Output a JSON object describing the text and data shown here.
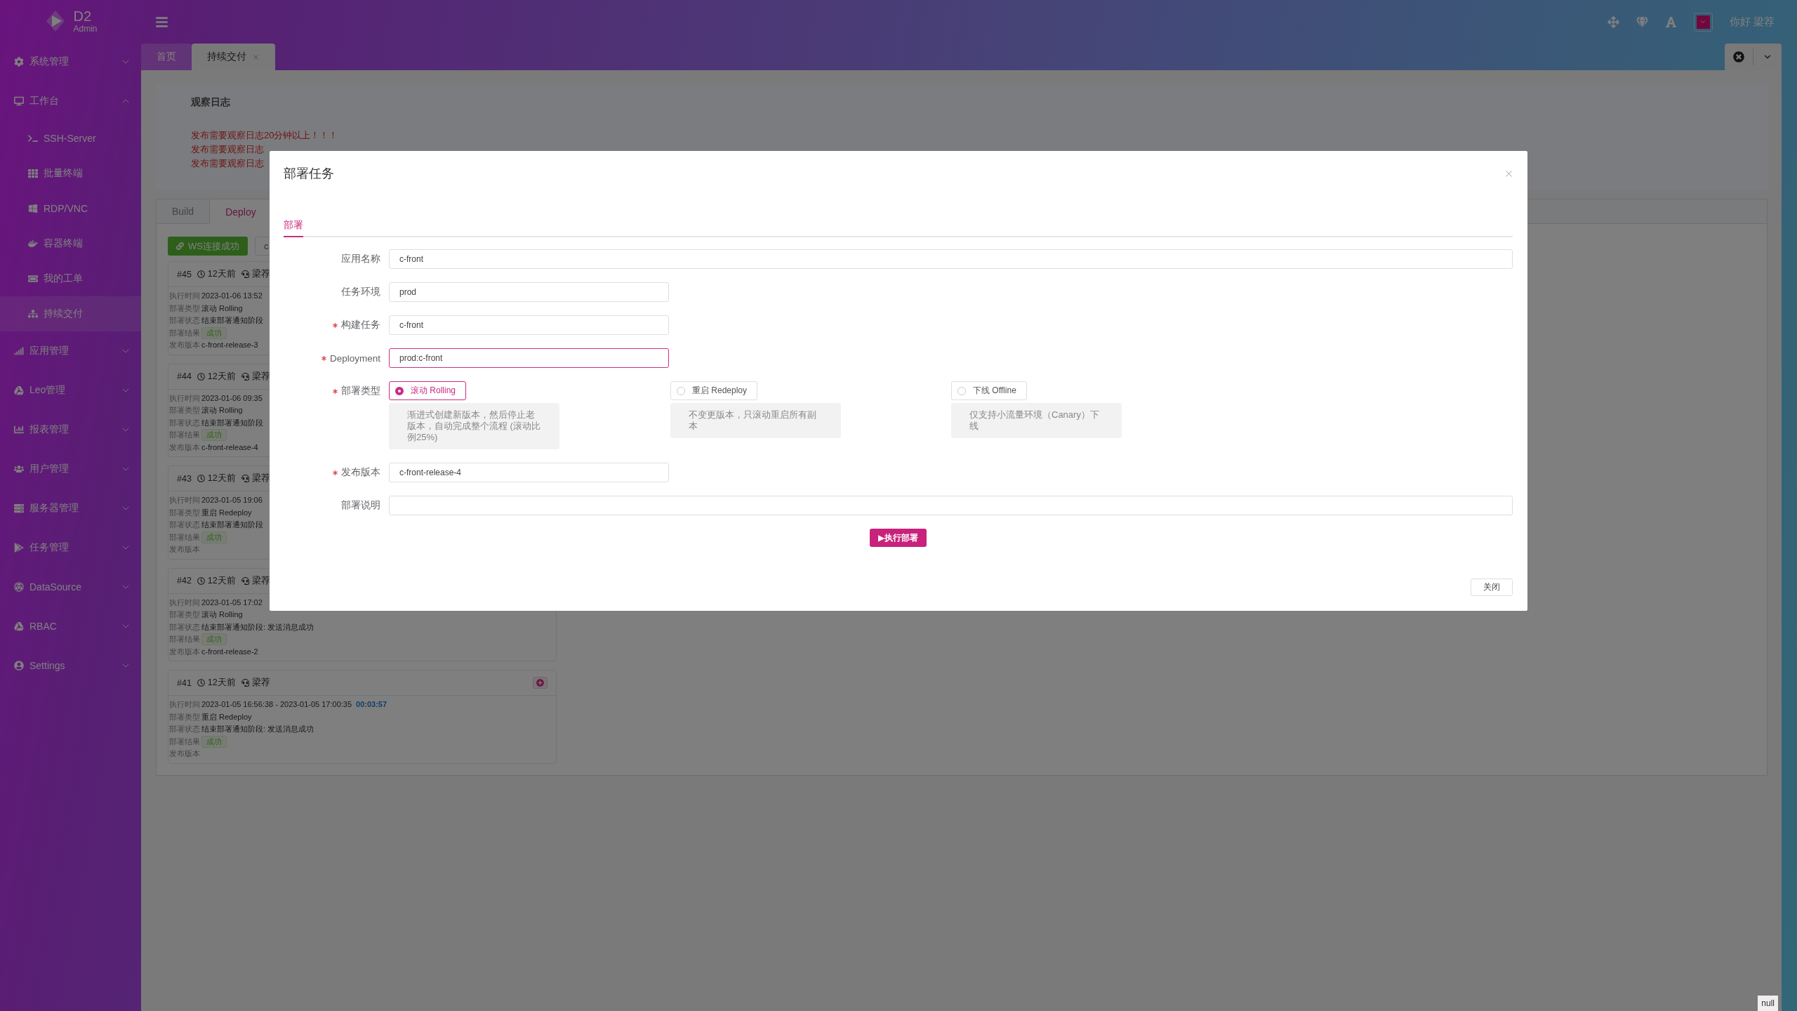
{
  "brand": {
    "name": "D2",
    "sub": "Admin"
  },
  "sidebar": {
    "items": [
      {
        "label": "系统管理",
        "expanded": false,
        "selected": false
      },
      {
        "label": "工作台",
        "expanded": true,
        "selected": false,
        "children": [
          {
            "label": "SSH-Server",
            "selected": false
          },
          {
            "label": "批量终端",
            "selected": false
          },
          {
            "label": "RDP/VNC",
            "selected": false
          },
          {
            "label": "容器终端",
            "selected": false
          },
          {
            "label": "我的工单",
            "selected": false
          },
          {
            "label": "持续交付",
            "selected": true
          }
        ]
      },
      {
        "label": "应用管理",
        "expanded": false,
        "selected": false
      },
      {
        "label": "Leo管理",
        "expanded": false,
        "selected": false
      },
      {
        "label": "报表管理",
        "expanded": false,
        "selected": false
      },
      {
        "label": "用户管理",
        "expanded": false,
        "selected": false
      },
      {
        "label": "服务器管理",
        "expanded": false,
        "selected": false
      },
      {
        "label": "任务管理",
        "expanded": false,
        "selected": false
      },
      {
        "label": "DataSource",
        "expanded": false,
        "selected": false
      },
      {
        "label": "RBAC",
        "expanded": false,
        "selected": false
      },
      {
        "label": "Settings",
        "expanded": false,
        "selected": false
      }
    ]
  },
  "header": {
    "greeting": "你好 梁荐"
  },
  "page_tabs": [
    {
      "label": "首页",
      "selected": false,
      "closable": false
    },
    {
      "label": "持续交付",
      "selected": true,
      "closable": true
    }
  ],
  "log": {
    "title": "观察日志",
    "lines": [
      "发布需要观察日志20分钟以上！！！",
      "发布需要观察日志",
      "发布需要观察日志"
    ]
  },
  "work_tabs": [
    {
      "label": "Build",
      "selected": false
    },
    {
      "label": "Deploy",
      "selected": true
    }
  ],
  "toolbar": {
    "ws_button": "WS连接成功",
    "second_button": "c"
  },
  "records": [
    {
      "id": "#45",
      "age": "12天前",
      "user": "梁荐",
      "fields": [
        {
          "label": "执行时间",
          "value": "2023-01-06 13:52"
        },
        {
          "label": "部署类型",
          "value": "滚动 Rolling"
        },
        {
          "label": "部署状态",
          "value": "结束部署通知阶段"
        },
        {
          "label": "部署结果",
          "value": "成功",
          "kind": "tag"
        },
        {
          "label": "发布版本",
          "value": "c-front-release-3"
        }
      ]
    },
    {
      "id": "#44",
      "age": "12天前",
      "user": "梁荐",
      "fields": [
        {
          "label": "执行时间",
          "value": "2023-01-06 09:35"
        },
        {
          "label": "部署类型",
          "value": "滚动 Rolling"
        },
        {
          "label": "部署状态",
          "value": "结束部署通知阶段"
        },
        {
          "label": "部署结果",
          "value": "成功",
          "kind": "tag"
        },
        {
          "label": "发布版本",
          "value": "c-front-release-4"
        }
      ]
    },
    {
      "id": "#43",
      "age": "12天前",
      "user": "梁荐",
      "fields": [
        {
          "label": "执行时间",
          "value": "2023-01-05 19:06"
        },
        {
          "label": "部署类型",
          "value": "重启 Redeploy"
        },
        {
          "label": "部署状态",
          "value": "结束部署通知阶段"
        },
        {
          "label": "部署结果",
          "value": "成功",
          "kind": "tag"
        },
        {
          "label": "发布版本"
        }
      ]
    },
    {
      "id": "#42",
      "age": "12天前",
      "user": "梁荐",
      "fields": [
        {
          "label": "执行时间",
          "value": "2023-01-05 17:02"
        },
        {
          "label": "部署类型",
          "value": "滚动 Rolling"
        },
        {
          "label": "部署状态",
          "value": "结束部署通知阶段: 发送消息成功"
        },
        {
          "label": "部署结果",
          "value": "成功",
          "kind": "tag"
        },
        {
          "label": "发布版本",
          "value": "c-front-release-2"
        }
      ]
    },
    {
      "id": "#41",
      "age": "12天前",
      "user": "梁荐",
      "add_button": true,
      "fields": [
        {
          "label": "执行时间",
          "value": "2023-01-05 16:56:38 - 2023-01-05 17:00:35",
          "duration": "00:03:57"
        },
        {
          "label": "部署类型",
          "value": "重启 Redeploy"
        },
        {
          "label": "部署状态",
          "value": "结束部署通知阶段: 发送消息成功"
        },
        {
          "label": "部署结果",
          "value": "成功",
          "kind": "tag"
        },
        {
          "label": "发布版本"
        }
      ]
    }
  ],
  "modal": {
    "title": "部署任务",
    "tabs": [
      {
        "label": "部署",
        "selected": true
      }
    ],
    "rows": [
      {
        "label": "应用名称",
        "required": false,
        "kind": "wide_input",
        "value": "c-front"
      },
      {
        "label": "任务环境",
        "required": false,
        "kind": "input",
        "value": "prod"
      },
      {
        "label": "构建任务",
        "required": true,
        "kind": "input",
        "value": "c-front"
      },
      {
        "label": "Deployment",
        "required": true,
        "kind": "input",
        "value": "prod:c-front",
        "focused": true
      },
      {
        "label": "部署类型",
        "required": true,
        "kind": "radio",
        "options": [
          {
            "label": "滚动 Rolling",
            "selected": true,
            "hint": "渐进式创建新版本，然后停止老版本，自动完成整个流程 (滚动比例25%)"
          },
          {
            "label": "重启 Redeploy",
            "selected": false,
            "hint": "不变更版本，只滚动重启所有副本"
          },
          {
            "label": "下线 Offline",
            "selected": false,
            "hint": "仅支持小流量环境（Canary）下线"
          }
        ]
      },
      {
        "label": "发布版本",
        "required": true,
        "kind": "input",
        "value": "c-front-release-4"
      },
      {
        "label": "部署说明",
        "required": false,
        "kind": "wide_input"
      }
    ],
    "submit": "▶执行部署",
    "close_button": "关闭"
  },
  "debug_badge": "null"
}
